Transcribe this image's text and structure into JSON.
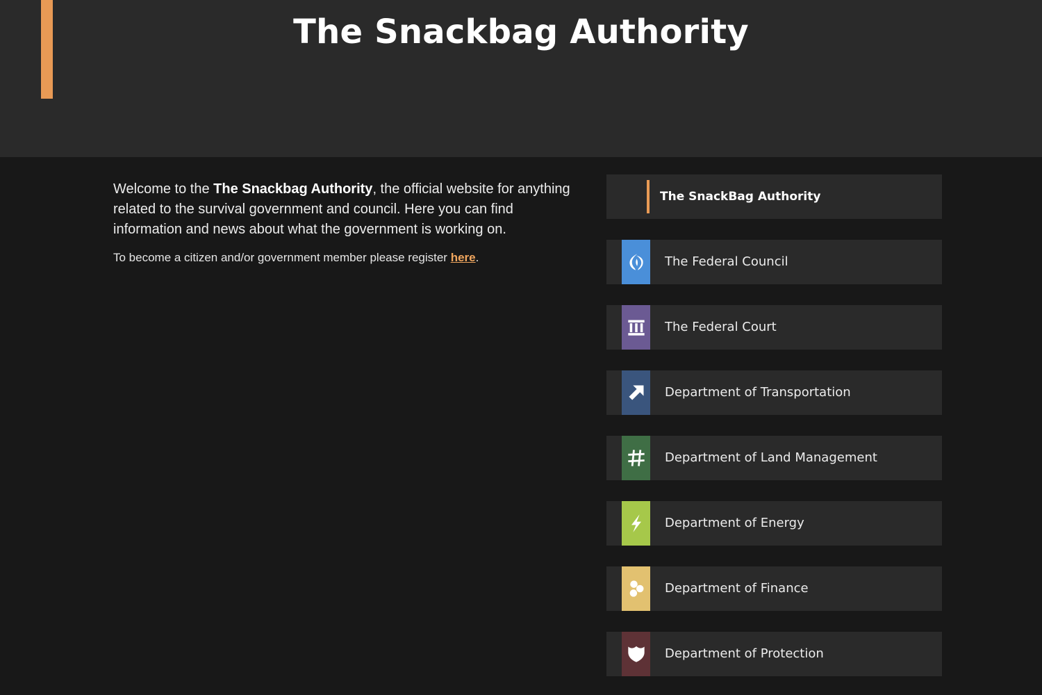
{
  "header": {
    "title": "The Snackbag Authority",
    "accent_color": "#e89a55"
  },
  "intro": {
    "welcome_prefix": "Welcome to the ",
    "welcome_bold": "The Snackbag Authority",
    "welcome_suffix": ", the official website for anything related to the survival government and council. Here you can find information and news about what the government is working on.",
    "register_prefix": "To become a citizen and/or government member please register ",
    "register_link": "here",
    "register_suffix": "."
  },
  "nav": {
    "top_label": "The SnackBag Authority",
    "items": [
      {
        "label": "The Federal Council",
        "icon": "federal-council-icon",
        "color": "#4a8fd9"
      },
      {
        "label": "The Federal Court",
        "icon": "courthouse-icon",
        "color": "#6b5a93"
      },
      {
        "label": "Department of Transportation",
        "icon": "arrow-icon",
        "color": "#3a557d"
      },
      {
        "label": "Department of Land Management",
        "icon": "grid-icon",
        "color": "#3f6e45"
      },
      {
        "label": "Department of Energy",
        "icon": "lightning-icon",
        "color": "#a6c84a"
      },
      {
        "label": "Department of Finance",
        "icon": "coins-icon",
        "color": "#e2c170"
      },
      {
        "label": "Department of Protection",
        "icon": "shield-icon",
        "color": "#5e3236"
      }
    ]
  }
}
